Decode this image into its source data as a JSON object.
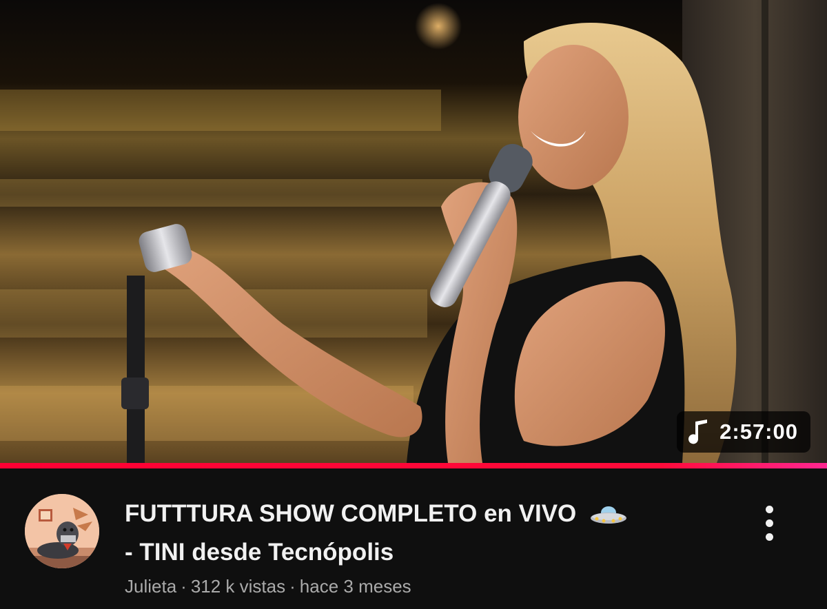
{
  "video": {
    "duration": "2:57:00",
    "duration_icon": "music-note-icon",
    "progress_fraction": 1.0,
    "progress_color": "#ff0033",
    "title_line1": "FUTTTURA SHOW COMPLETO en VIVO",
    "title_emoji_icon": "ufo-icon",
    "title_line2": "- TINI desde Tecnópolis",
    "channel": "Julieta",
    "views": "312 k vistas",
    "age": "hace 3 meses",
    "separator": "·"
  },
  "thumbnail": {
    "description_icon": "singer-thumbnail-image"
  },
  "actions": {
    "more_icon": "more-vertical-icon"
  }
}
